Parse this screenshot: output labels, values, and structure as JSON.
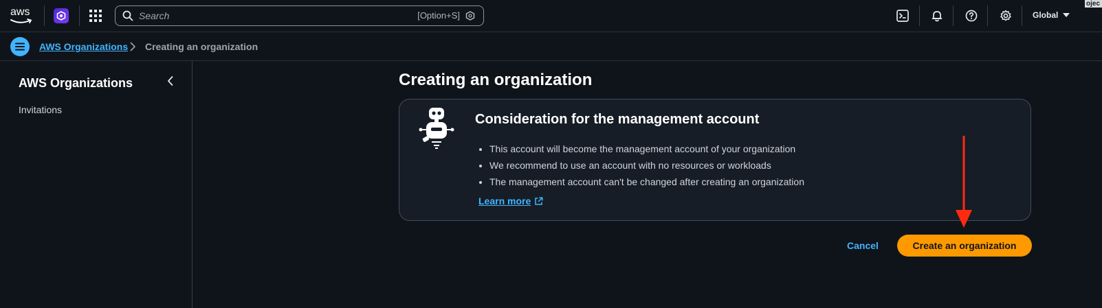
{
  "topbar": {
    "logo_text": "aws",
    "search": {
      "placeholder": "Search",
      "shortcut": "[Option+S]"
    },
    "region_label": "Global",
    "corner_tag": "ojec"
  },
  "breadcrumb": {
    "root": "AWS Organizations",
    "current": "Creating an organization"
  },
  "sidebar": {
    "title": "AWS Organizations",
    "items": [
      {
        "label": "Invitations"
      }
    ]
  },
  "main": {
    "title": "Creating an organization",
    "card": {
      "title": "Consideration for the management account",
      "bullets": [
        "This account will become the management account of your organization",
        "We recommend to use an account with no resources or workloads",
        "The management account can't be changed after creating an organization"
      ],
      "learn_more": "Learn more"
    },
    "actions": {
      "cancel": "Cancel",
      "create": "Create an organization"
    }
  },
  "colors": {
    "background": "#0f141a",
    "accent_link": "#42b4ff",
    "primary_button": "#ff9900",
    "annotation_arrow": "#ff2a10"
  },
  "icons": {
    "service": "organizations-service-icon",
    "apps": "apps-grid-icon",
    "cloudshell": "cloudshell-icon",
    "notifications": "bell-icon",
    "help": "help-icon",
    "settings": "gear-icon"
  }
}
